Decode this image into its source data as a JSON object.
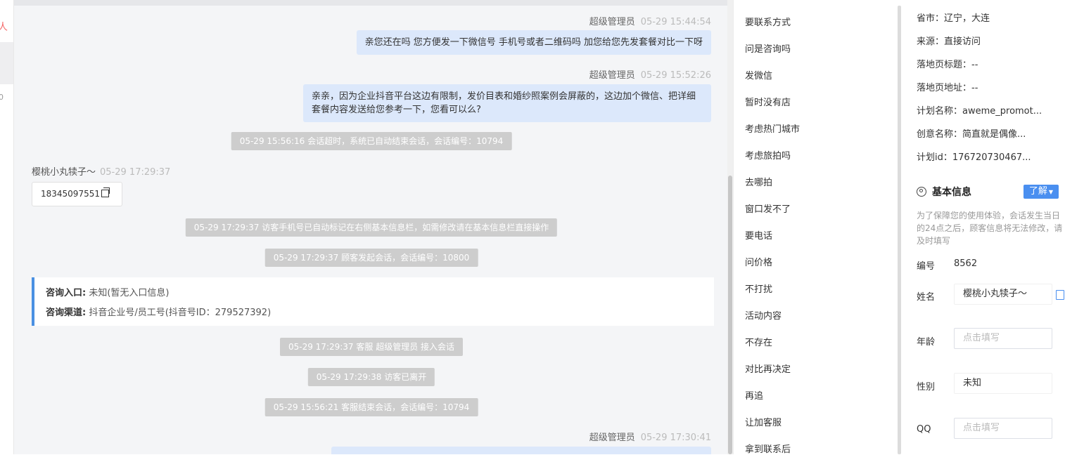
{
  "left_strip": {
    "mark_red": "人",
    "mark_num": "0"
  },
  "chat": {
    "messages": [
      {
        "sender": "超级管理员",
        "time": "05-29 15:44:54",
        "text": "亲您还在吗 您方便发一下微信号 手机号或者二维码吗 加您给您先发套餐对比一下呀"
      },
      {
        "sender": "超级管理员",
        "time": "05-29 15:52:26",
        "line1": "亲亲，因为企业抖音平台这边有限制，发价目表和婚纱照案例会屏蔽的，这边加个微信、把详细",
        "line2": "套餐内容发送给您参考一下，您看可以么?"
      },
      {
        "sender": "超级管理员",
        "time": "05-29 17:30:41"
      }
    ],
    "system": [
      "05-29 15:56:16 会话超时，系统已自动结束会话，会话编号：10794",
      "05-29 17:29:37 访客手机号已自动标记在右侧基本信息栏，如需修改请在基本信息栏直接操作",
      "05-29 17:29:37 顾客发起会话，会话编号：10800",
      "05-29 17:29:37 客服 超级管理员 接入会话",
      "05-29 17:29:38 访客已离开",
      "05-29 15:56:21 客服结束会话，会话编号：10794"
    ],
    "visitor": {
      "name": "樱桃小丸犊子～",
      "time": "05-29 17:29:37",
      "phone": "18345097551"
    },
    "info_card": {
      "entry_label": "咨询入口:",
      "entry_value": "未知(暂无入口信息)",
      "channel_label": "咨询渠道:",
      "channel_value": "抖音企业号/员工号(抖音号ID：279527392)"
    }
  },
  "quick_replies": [
    "要联系方式",
    "问是咨询吗",
    "发微信",
    "暂时没有店",
    "考虑热门城市",
    "考虑旅拍吗",
    "去哪拍",
    "窗口发不了",
    "要电话",
    "问价格",
    "不打扰",
    "活动内容",
    "不存在",
    "对比再决定",
    "再追",
    "让加客服",
    "拿到联系后"
  ],
  "info": {
    "lines": [
      "省市：辽宁，大连",
      "来源：直接访问",
      "落地页标题：--",
      "落地页地址：--",
      "计划名称：aweme_promot...",
      "创意名称：简直就是偶像...",
      "计划id：176720730467..."
    ],
    "section_title": "基本信息",
    "know_button": "了解",
    "tip": "为了保障您的使用体验，会话发生当日的24点之后，顾客信息将无法修改，请及时填写",
    "id_label": "编号",
    "id_value": "8562",
    "name_label": "姓名",
    "name_value": "樱桃小丸犊子～",
    "age_label": "年龄",
    "age_placeholder": "点击填写",
    "gender_label": "性别",
    "gender_value": "未知",
    "qq_label": "QQ",
    "qq_placeholder": "点击填写"
  }
}
